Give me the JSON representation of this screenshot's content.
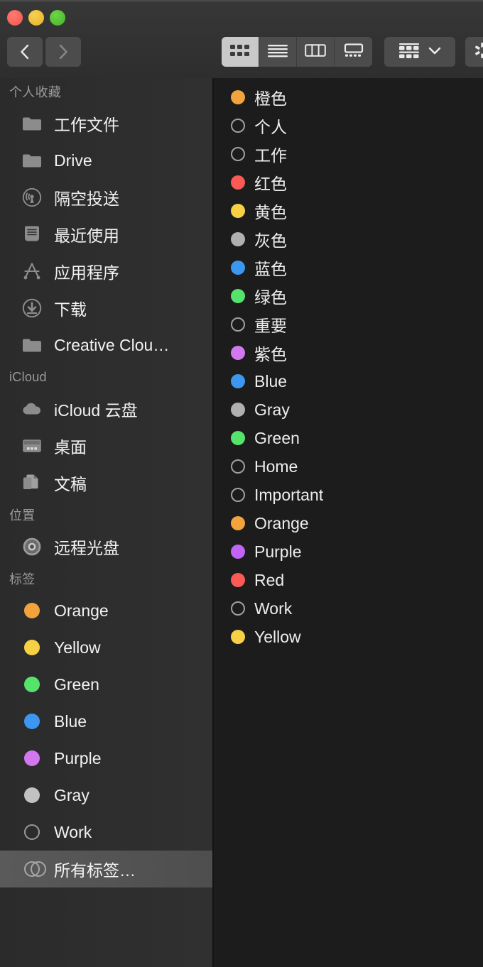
{
  "window": {
    "traffic_lights": [
      {
        "name": "close",
        "color": "#f2554d"
      },
      {
        "name": "minimize",
        "color": "#e8b321"
      },
      {
        "name": "zoom",
        "color": "#3fb625"
      }
    ]
  },
  "toolbar": {
    "back_label": "返回",
    "forward_label": "前进",
    "views": [
      {
        "id": "icon-view",
        "label": "图标显示",
        "active": true
      },
      {
        "id": "list-view",
        "label": "列表显示",
        "active": false
      },
      {
        "id": "column-view",
        "label": "分栏显示",
        "active": false
      },
      {
        "id": "gallery-view",
        "label": "画廊显示",
        "active": false
      }
    ],
    "arrange_label": "排列方式",
    "action_label": "操作"
  },
  "sidebar": {
    "sections": [
      {
        "header": "个人收藏",
        "items": [
          {
            "icon": "folder-icon",
            "label": "工作文件",
            "selected": false
          },
          {
            "icon": "folder-icon",
            "label": "Drive",
            "selected": false
          },
          {
            "icon": "airdrop-icon",
            "label": "隔空投送",
            "selected": false
          },
          {
            "icon": "recents-icon",
            "label": "最近使用",
            "selected": false
          },
          {
            "icon": "applications-icon",
            "label": "应用程序",
            "selected": false
          },
          {
            "icon": "downloads-icon",
            "label": "下载",
            "selected": false
          },
          {
            "icon": "folder-icon",
            "label": "Creative Clou…",
            "selected": false
          }
        ]
      },
      {
        "header": "iCloud",
        "items": [
          {
            "icon": "cloud-icon",
            "label": "iCloud 云盘",
            "selected": false
          },
          {
            "icon": "desktop-icon",
            "label": "桌面",
            "selected": false
          },
          {
            "icon": "documents-icon",
            "label": "文稿",
            "selected": false
          }
        ]
      },
      {
        "header": "位置",
        "items": [
          {
            "icon": "disc-icon",
            "label": "远程光盘",
            "selected": false
          }
        ]
      },
      {
        "header": "标签",
        "items": [
          {
            "icon": "tag-dot",
            "label": "Orange",
            "color": "#f2a33c",
            "selected": false
          },
          {
            "icon": "tag-dot",
            "label": "Yellow",
            "color": "#f7d045",
            "selected": false
          },
          {
            "icon": "tag-dot",
            "label": "Green",
            "color": "#55e36b",
            "selected": false
          },
          {
            "icon": "tag-dot",
            "label": "Blue",
            "color": "#3c97f0",
            "selected": false
          },
          {
            "icon": "tag-dot",
            "label": "Purple",
            "color": "#d277f0",
            "selected": false
          },
          {
            "icon": "tag-dot",
            "label": "Gray",
            "color": "#c2c2c2",
            "selected": false
          },
          {
            "icon": "tag-dot-hollow",
            "label": "Work",
            "color": "",
            "selected": false
          },
          {
            "icon": "tag-dot-double",
            "label": "所有标签…",
            "color": "",
            "selected": true
          }
        ]
      }
    ]
  },
  "main": {
    "rows": [
      {
        "label": "橙色",
        "color": "#f2a33c",
        "hollow": false
      },
      {
        "label": "个人",
        "color": "",
        "hollow": true
      },
      {
        "label": "工作",
        "color": "",
        "hollow": true
      },
      {
        "label": "红色",
        "color": "#fa5a56",
        "hollow": false
      },
      {
        "label": "黄色",
        "color": "#f7d045",
        "hollow": false
      },
      {
        "label": "灰色",
        "color": "#b0b0b0",
        "hollow": false
      },
      {
        "label": "蓝色",
        "color": "#3c97f0",
        "hollow": false
      },
      {
        "label": "绿色",
        "color": "#55e36b",
        "hollow": false
      },
      {
        "label": "重要",
        "color": "",
        "hollow": true
      },
      {
        "label": "紫色",
        "color": "#d277f0",
        "hollow": false
      },
      {
        "label": "Blue",
        "color": "#3c97f0",
        "hollow": false
      },
      {
        "label": "Gray",
        "color": "#b0b0b0",
        "hollow": false
      },
      {
        "label": "Green",
        "color": "#55e36b",
        "hollow": false
      },
      {
        "label": "Home",
        "color": "",
        "hollow": true
      },
      {
        "label": "Important",
        "color": "",
        "hollow": true
      },
      {
        "label": "Orange",
        "color": "#f2a33c",
        "hollow": false
      },
      {
        "label": "Purple",
        "color": "#c164f5",
        "hollow": false
      },
      {
        "label": "Red",
        "color": "#fa5a56",
        "hollow": false
      },
      {
        "label": "Work",
        "color": "",
        "hollow": true
      },
      {
        "label": "Yellow",
        "color": "#f7d045",
        "hollow": false
      }
    ]
  }
}
